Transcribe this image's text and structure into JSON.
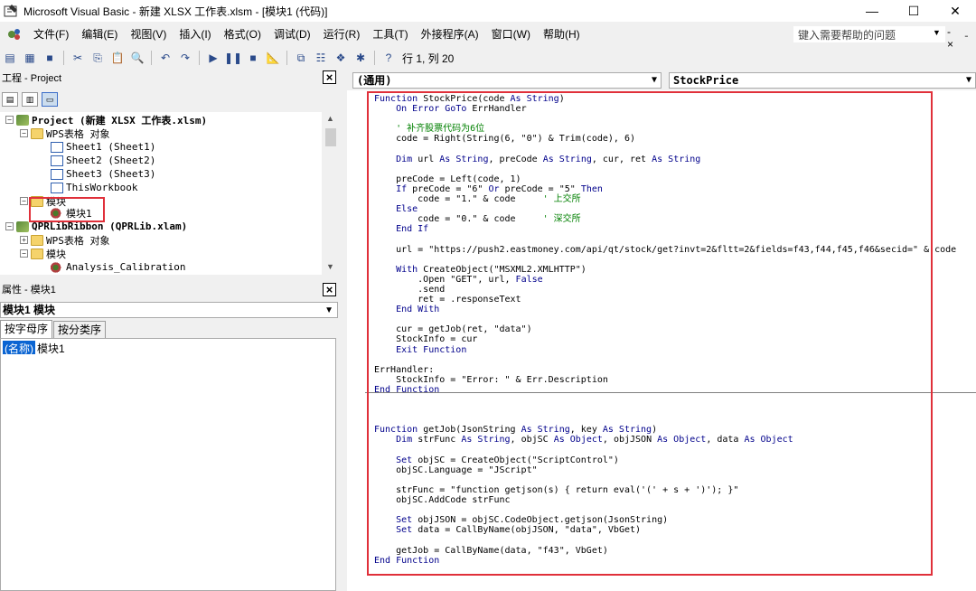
{
  "window": {
    "title": "Microsoft Visual Basic - 新建 XLSX 工作表.xlsm - [模块1 (代码)]",
    "minimize": "—",
    "maximize": "☐",
    "close": "✕"
  },
  "menu": {
    "items": [
      "文件(F)",
      "编辑(E)",
      "视图(V)",
      "插入(I)",
      "格式(O)",
      "调试(D)",
      "运行(R)",
      "工具(T)",
      "外接程序(A)",
      "窗口(W)",
      "帮助(H)"
    ],
    "help_placeholder": "键入需要帮助的问题",
    "right_controls": "- ˍ ×"
  },
  "toolbar": {
    "position_text": "行 1, 列 20"
  },
  "project": {
    "title": "工程 - Project",
    "tree": [
      {
        "label": "Project (新建 XLSX 工作表.xlsm)",
        "bold": true,
        "level": 0,
        "icon": "project-icon",
        "expander": "−"
      },
      {
        "label": "WPS表格 对象",
        "level": 1,
        "icon": "folder-icon",
        "expander": "−"
      },
      {
        "label": "Sheet1 (Sheet1)",
        "level": 2,
        "icon": "sheet-icon"
      },
      {
        "label": "Sheet2 (Sheet2)",
        "level": 2,
        "icon": "sheet-icon"
      },
      {
        "label": "Sheet3 (Sheet3)",
        "level": 2,
        "icon": "sheet-icon"
      },
      {
        "label": "ThisWorkbook",
        "level": 2,
        "icon": "sheet-icon"
      },
      {
        "label": "模块",
        "level": 1,
        "icon": "folder-icon",
        "expander": "−"
      },
      {
        "label": "模块1",
        "level": 2,
        "icon": "module-icon"
      },
      {
        "label": "QPRLibRibbon (QPRLib.xlam)",
        "bold": true,
        "level": 0,
        "icon": "project-icon",
        "expander": "−"
      },
      {
        "label": "WPS表格 对象",
        "level": 1,
        "icon": "folder-icon",
        "expander": "+"
      },
      {
        "label": "模块",
        "level": 1,
        "icon": "folder-icon",
        "expander": "−"
      },
      {
        "label": "Analysis_Calibration",
        "level": 2,
        "icon": "module-icon"
      }
    ]
  },
  "properties": {
    "title": "属性 - 模块1",
    "object": "模块1 模块",
    "tabs": [
      "按字母序",
      "按分类序"
    ],
    "rows": [
      {
        "name": "(名称)",
        "value": "模块1"
      }
    ]
  },
  "code": {
    "object_combo": "(通用)",
    "proc_combo": "StockPrice",
    "lines": [
      [
        [
          "kw",
          "Function "
        ],
        [
          "",
          "StockPrice(code "
        ],
        [
          "kw",
          "As String"
        ],
        [
          "",
          ")"
        ]
      ],
      [
        [
          "",
          "    "
        ],
        [
          "kw",
          "On Error GoTo "
        ],
        [
          "",
          "ErrHandler"
        ]
      ],
      [
        [
          "",
          ""
        ]
      ],
      [
        [
          "cm",
          "    ' 补齐股票代码为6位"
        ]
      ],
      [
        [
          "",
          "    code = Right(String(6, \"0\") & Trim(code), 6)"
        ]
      ],
      [
        [
          "",
          ""
        ]
      ],
      [
        [
          "",
          "    "
        ],
        [
          "kw",
          "Dim "
        ],
        [
          "",
          "url "
        ],
        [
          "kw",
          "As String"
        ],
        [
          "",
          ", preCode "
        ],
        [
          "kw",
          "As String"
        ],
        [
          "",
          ", cur, ret "
        ],
        [
          "kw",
          "As String"
        ]
      ],
      [
        [
          "",
          ""
        ]
      ],
      [
        [
          "",
          "    preCode = Left(code, 1)"
        ]
      ],
      [
        [
          "",
          "    "
        ],
        [
          "kw",
          "If "
        ],
        [
          "",
          "preCode = \"6\" "
        ],
        [
          "kw",
          "Or "
        ],
        [
          "",
          "preCode = \"5\" "
        ],
        [
          "kw",
          "Then"
        ]
      ],
      [
        [
          "",
          "        code = \"1.\" & code     "
        ],
        [
          "cm",
          "' 上交所"
        ]
      ],
      [
        [
          "kw",
          "    Else"
        ]
      ],
      [
        [
          "",
          "        code = \"0.\" & code     "
        ],
        [
          "cm",
          "' 深交所"
        ]
      ],
      [
        [
          "kw",
          "    End If"
        ]
      ],
      [
        [
          "",
          ""
        ]
      ],
      [
        [
          "",
          "    url = \"https://push2.eastmoney.com/api/qt/stock/get?invt=2&fltt=2&fields=f43,f44,f45,f46&secid=\" & code"
        ]
      ],
      [
        [
          "",
          ""
        ]
      ],
      [
        [
          "",
          "    "
        ],
        [
          "kw",
          "With "
        ],
        [
          "",
          "CreateObject(\"MSXML2.XMLHTTP\")"
        ]
      ],
      [
        [
          "",
          "        .Open \"GET\", url, "
        ],
        [
          "kw",
          "False"
        ]
      ],
      [
        [
          "",
          "        .send"
        ]
      ],
      [
        [
          "",
          "        ret = .responseText"
        ]
      ],
      [
        [
          "kw",
          "    End With"
        ]
      ],
      [
        [
          "",
          ""
        ]
      ],
      [
        [
          "",
          "    cur = getJob(ret, \"data\")"
        ]
      ],
      [
        [
          "",
          "    StockInfo = cur"
        ]
      ],
      [
        [
          "kw",
          "    Exit Function"
        ]
      ],
      [
        [
          "",
          ""
        ]
      ],
      [
        [
          "",
          "ErrHandler:"
        ]
      ],
      [
        [
          "",
          "    StockInfo = \"Error: \" & Err.Description"
        ]
      ],
      [
        [
          "kw",
          "End Function"
        ]
      ],
      [
        [
          "",
          ""
        ]
      ],
      [
        [
          "",
          ""
        ]
      ],
      [
        [
          "",
          ""
        ]
      ],
      [
        [
          "kw",
          "Function "
        ],
        [
          "",
          "getJob(JsonString "
        ],
        [
          "kw",
          "As String"
        ],
        [
          "",
          ", key "
        ],
        [
          "kw",
          "As String"
        ],
        [
          "",
          ")"
        ]
      ],
      [
        [
          "",
          "    "
        ],
        [
          "kw",
          "Dim "
        ],
        [
          "",
          "strFunc "
        ],
        [
          "kw",
          "As String"
        ],
        [
          "",
          ", objSC "
        ],
        [
          "kw",
          "As Object"
        ],
        [
          "",
          ", objJSON "
        ],
        [
          "kw",
          "As Object"
        ],
        [
          "",
          ", data "
        ],
        [
          "kw",
          "As Object"
        ]
      ],
      [
        [
          "",
          ""
        ]
      ],
      [
        [
          "",
          "    "
        ],
        [
          "kw",
          "Set "
        ],
        [
          "",
          "objSC = CreateObject(\"ScriptControl\")"
        ]
      ],
      [
        [
          "",
          "    objSC.Language = \"JScript\""
        ]
      ],
      [
        [
          "",
          ""
        ]
      ],
      [
        [
          "",
          "    strFunc = \"function getjson(s) { return eval('(' + s + ')'); }\""
        ]
      ],
      [
        [
          "",
          "    objSC.AddCode strFunc"
        ]
      ],
      [
        [
          "",
          ""
        ]
      ],
      [
        [
          "",
          "    "
        ],
        [
          "kw",
          "Set "
        ],
        [
          "",
          "objJSON = objSC.CodeObject.getjson(JsonString)"
        ]
      ],
      [
        [
          "",
          "    "
        ],
        [
          "kw",
          "Set "
        ],
        [
          "",
          "data = CallByName(objJSON, \"data\", VbGet)"
        ]
      ],
      [
        [
          "",
          ""
        ]
      ],
      [
        [
          "",
          "    getJob = CallByName(data, \"f43\", VbGet)"
        ]
      ],
      [
        [
          "kw",
          "End Function"
        ]
      ]
    ]
  }
}
